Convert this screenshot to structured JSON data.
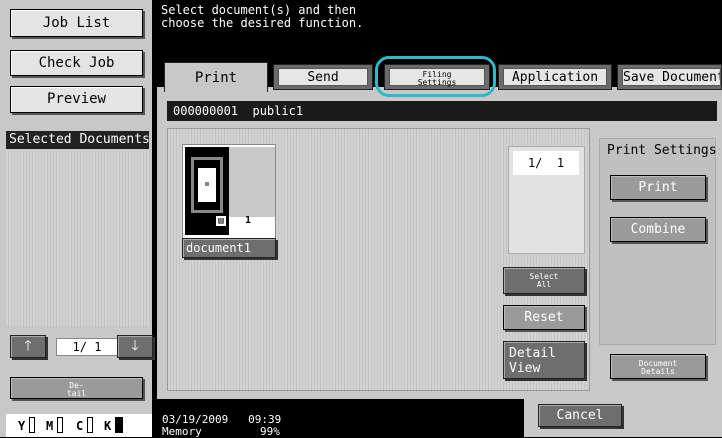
{
  "left_panel": {
    "job_list": "Job List",
    "check_job": "Check Job",
    "preview": "Preview",
    "selected_documents": "Selected Documents",
    "pager": "1/  1",
    "detail_line1": "De-",
    "detail_line2": "tail",
    "toner": [
      "Y",
      "M",
      "C",
      "K"
    ]
  },
  "header": {
    "message_line1": "Select document(s) and then",
    "message_line2": "choose the desired function."
  },
  "tabs": {
    "print": "Print",
    "send": "Send",
    "filing_line1": "Filing",
    "filing_line2": "Settings",
    "application": "Application",
    "save_document": "Save Document"
  },
  "box_info": "000000001  public1",
  "document": {
    "name": "document1",
    "copies": "1"
  },
  "page_counter": "1/  1",
  "buttons": {
    "select_all_line1": "Select",
    "select_all_line2": "All",
    "reset": "Reset",
    "detail_view_line1": "Detail",
    "detail_view_line2": "View",
    "cancel": "Cancel"
  },
  "print_settings": {
    "title": "Print Settings",
    "print": "Print",
    "combine": "Combine",
    "document_details_line1": "Document",
    "document_details_line2": "Details"
  },
  "status": {
    "datetime": "03/19/2009   09:39",
    "memory_label": "Memory",
    "memory_value": "99%"
  },
  "colors": {
    "highlight": "#2fb9c9"
  }
}
